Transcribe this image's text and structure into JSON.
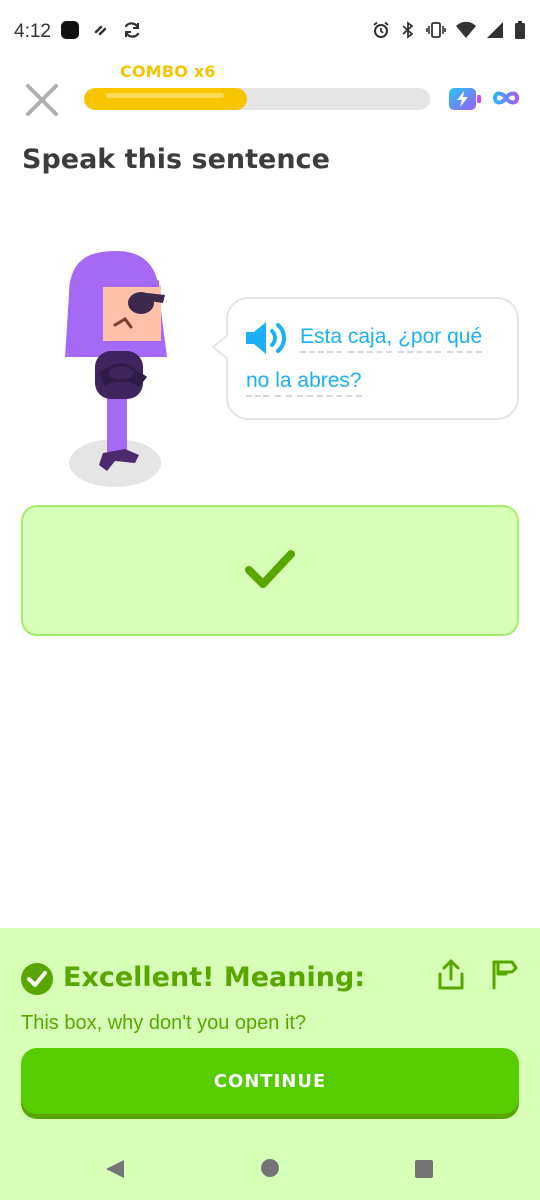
{
  "status_bar": {
    "time": "4:12",
    "icons": [
      "app-notification-icon",
      "link-icon",
      "sync-icon",
      "alarm-icon",
      "bluetooth-icon",
      "vibrate-icon",
      "wifi-icon",
      "signal-icon",
      "battery-icon"
    ]
  },
  "header": {
    "combo_label": "COMBO x6",
    "progress_fraction": 0.47,
    "close_icon": "close-icon",
    "energy_icon": "energy-battery-icon",
    "infinity_icon": "infinity-icon"
  },
  "exercise": {
    "title": "Speak this sentence",
    "sentence_line1_words": [
      "Esta",
      "caja,",
      "¿por",
      "qué"
    ],
    "sentence_line2_words": [
      "no",
      "la",
      "abres?"
    ],
    "speaker_icon": "speaker-icon"
  },
  "answer": {
    "check_icon": "checkmark-icon"
  },
  "feedback": {
    "heading": "Excellent! Meaning:",
    "meaning": "This box, why don't you open it?",
    "continue_label": "CONTINUE"
  },
  "colors": {
    "accent_green": "#58cc02",
    "dark_green": "#58a700",
    "light_green_bg": "#d7ffb8",
    "blue_text": "#1cb0f6",
    "combo_yellow": "#f5c400",
    "character_purple": "#a56af5"
  }
}
